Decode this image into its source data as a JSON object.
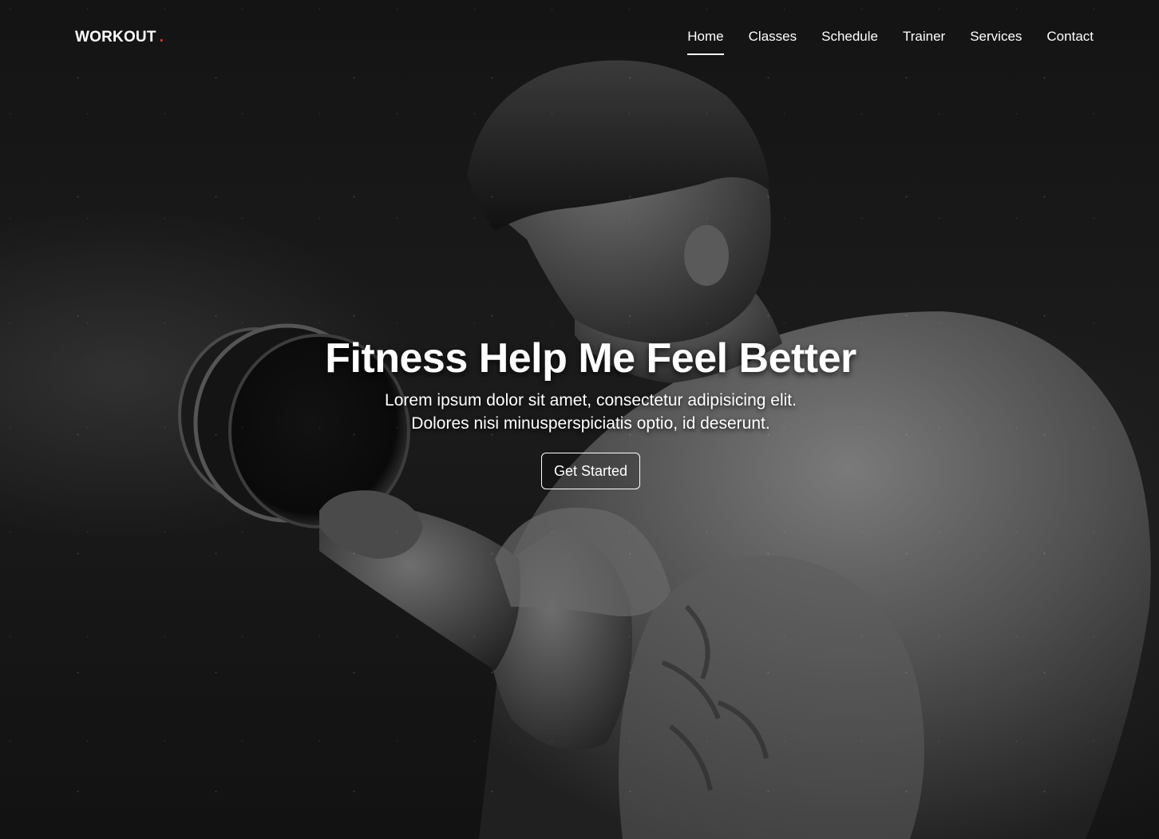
{
  "brand": {
    "name": "WORKOUT",
    "dot": ".",
    "accent_color": "#e53935"
  },
  "nav": {
    "items": [
      {
        "label": "Home",
        "active": true
      },
      {
        "label": "Classes",
        "active": false
      },
      {
        "label": "Schedule",
        "active": false
      },
      {
        "label": "Trainer",
        "active": false
      },
      {
        "label": "Services",
        "active": false
      },
      {
        "label": "Contact",
        "active": false
      }
    ]
  },
  "hero": {
    "title": "Fitness Help Me Feel Better",
    "subtitle": "Lorem ipsum dolor sit amet, consectetur adipisicing elit. Dolores nisi minusperspiciatis optio, id deserunt.",
    "cta_label": "Get Started",
    "background_image": "black-and-white-man-lifting-dumbbell"
  }
}
